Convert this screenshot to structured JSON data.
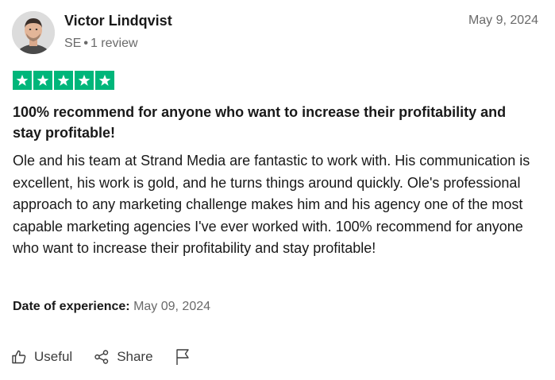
{
  "reviewer": {
    "name": "Victor Lindqvist",
    "country": "SE",
    "review_count": "1 review",
    "avatar_icon": "person-photo"
  },
  "review": {
    "date": "May 9, 2024",
    "rating": 5,
    "max_rating": 5,
    "star_color": "#00b67a",
    "title": "100% recommend for anyone who want to increase their profitability and stay profitable!",
    "body": "Ole and his team at Strand Media are fantastic to work with. His communication is excellent, his work is gold, and he turns things around quickly. Ole's professional approach to any marketing challenge makes him and his agency one of the most capable marketing agencies I've ever worked with. 100% recommend for anyone who want to increase their profitability and stay profitable!",
    "experience_label": "Date of experience:",
    "experience_date": "May 09, 2024"
  },
  "actions": {
    "useful_label": "Useful",
    "useful_icon": "thumbs-up-icon",
    "share_label": "Share",
    "share_icon": "share-icon",
    "flag_icon": "flag-icon"
  }
}
